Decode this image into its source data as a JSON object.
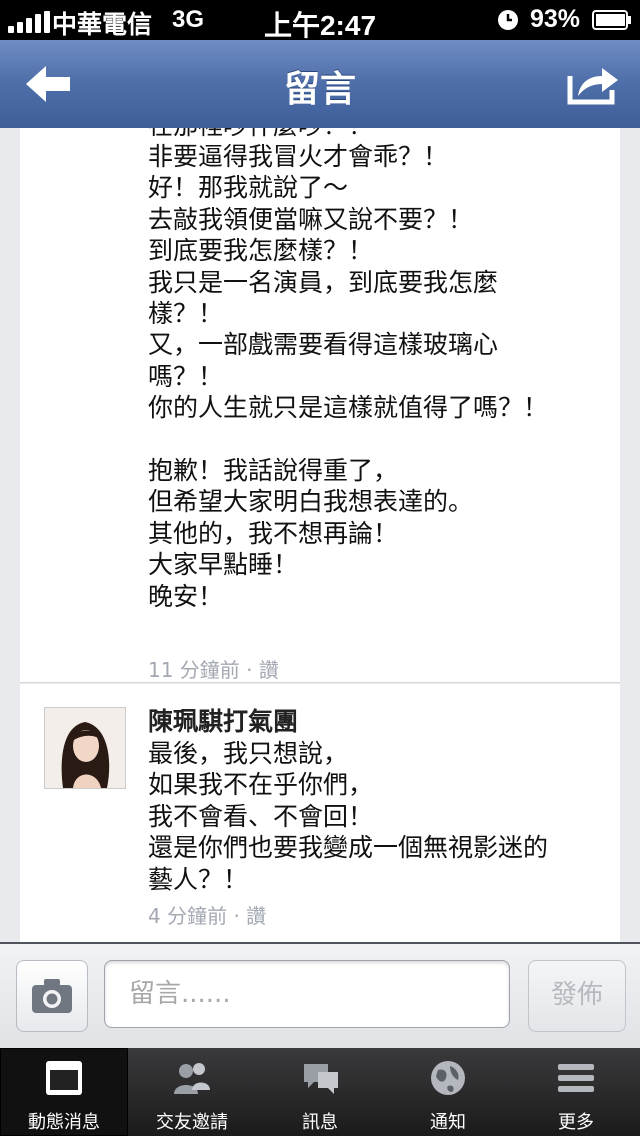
{
  "status_bar": {
    "carrier": "中華電信",
    "network": "3G",
    "time": "上午2:47",
    "battery": "93%"
  },
  "nav": {
    "title": "留言"
  },
  "comments": [
    {
      "partial_top_line": "在那裡吵什麼吵？！",
      "text": "非要逼得我冒火才會乖？！\n好！那我就說了～\n去敲我領便當嘛又說不要？！\n到底要我怎麼樣？！\n我只是一名演員，到底要我怎麼\n樣？！\n又，一部戲需要看得這樣玻璃心\n嗎？！\n你的人生就只是這樣就值得了嗎？！\n\n抱歉！我話說得重了，\n但希望大家明白我想表達的。\n其他的，我不想再論！\n大家早點睡！\n晚安！",
      "time": "11 分鐘前",
      "like": "讚"
    },
    {
      "author": "陳珮騏打氣團",
      "text": "最後，我只想說，\n如果我不在乎你們，\n我不會看、不會回！\n還是你們也要我變成一個無視影迷的\n藝人？！",
      "time": "4 分鐘前",
      "like": "讚"
    }
  ],
  "meta_separator": "·",
  "composer": {
    "placeholder": "留言......",
    "post_label": "發佈"
  },
  "tabs": [
    {
      "label": "動態消息",
      "icon": "news-feed-icon",
      "active": true
    },
    {
      "label": "交友邀請",
      "icon": "friend-requests-icon",
      "active": false
    },
    {
      "label": "訊息",
      "icon": "messages-icon",
      "active": false
    },
    {
      "label": "通知",
      "icon": "notifications-globe-icon",
      "active": false
    },
    {
      "label": "更多",
      "icon": "more-menu-icon",
      "active": false
    }
  ]
}
